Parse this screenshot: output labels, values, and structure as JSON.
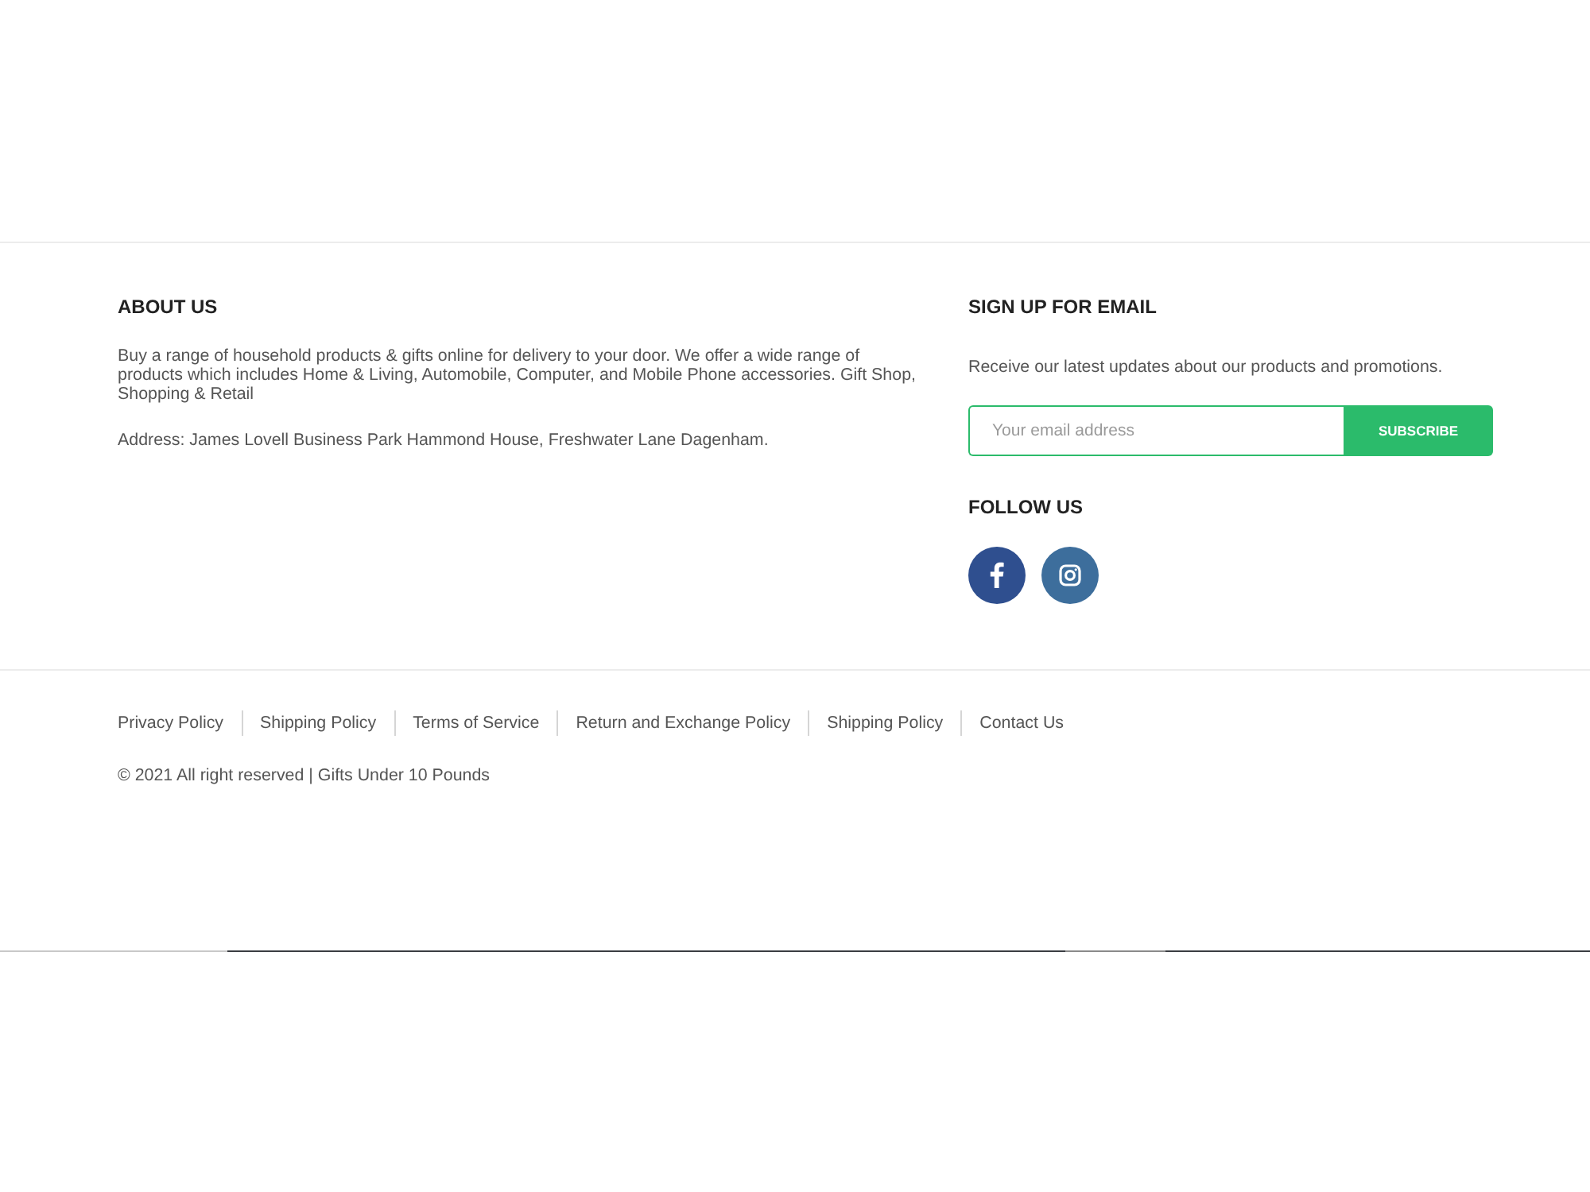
{
  "about": {
    "heading": "ABOUT US",
    "description": "Buy a range of household products & gifts online for delivery to your door. We offer a wide range of products which includes Home & Living, Automobile, Computer, and Mobile Phone accessories. Gift Shop, Shopping & Retail",
    "address": "Address: James Lovell Business Park Hammond House, Freshwater Lane Dagenham."
  },
  "newsletter": {
    "heading": "SIGN UP FOR EMAIL",
    "text": "Receive our latest updates about our products and promotions.",
    "email_field": {
      "placeholder": "Your email address"
    },
    "button": "SUBSCRIBE"
  },
  "follow_us": {
    "heading": "FOLLOW US",
    "links": [
      {
        "kind": "facebook"
      },
      {
        "kind": "instagram"
      }
    ]
  },
  "footer_links": [
    "Privacy Policy",
    "Shipping Policy",
    "Terms of Service",
    "Return and Exchange Policy",
    "Shipping Policy",
    "Contact Us"
  ],
  "copyright": "© 2021 All right reserved | Gifts Under 10 Pounds"
}
